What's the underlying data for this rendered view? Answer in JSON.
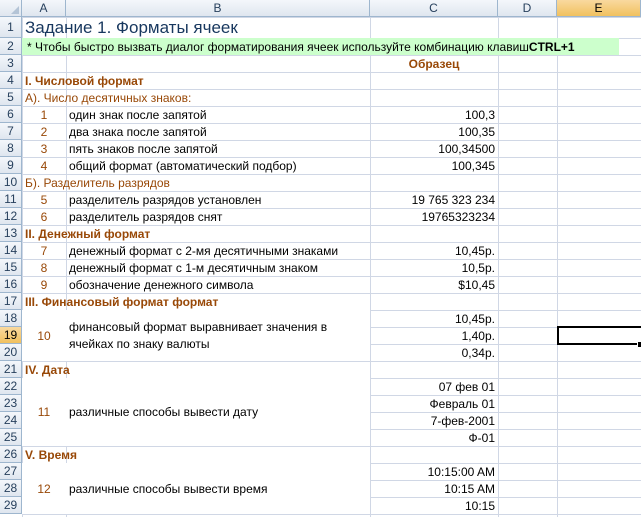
{
  "columns": [
    "A",
    "B",
    "C",
    "D",
    "E"
  ],
  "active_column": "E",
  "active_row": "19",
  "rows": [
    "1",
    "2",
    "3",
    "4",
    "5",
    "6",
    "7",
    "8",
    "9",
    "10",
    "11",
    "12",
    "13",
    "14",
    "15",
    "16",
    "17",
    "18",
    "19",
    "20",
    "21",
    "22",
    "23",
    "24",
    "25",
    "26",
    "27",
    "28",
    "29"
  ],
  "cells": {
    "title": "Задание 1. Форматы ячеек",
    "hint_text": "* Чтобы быстро вызвать диалог форматирования ячеек используйте комбинацию клавиш ",
    "hint_key": "CTRL+1",
    "sample_header": "Образец",
    "sec1": "I. Числовой формат",
    "sec1a": "А). Число десятичных знаков:",
    "n6": "1",
    "d6": "один знак после запятой",
    "v6": "100,3",
    "n7": "2",
    "d7": "два знака после запятой",
    "v7": "100,35",
    "n8": "3",
    "d8": "пять знаков после запятой",
    "v8": "100,34500",
    "n9": "4",
    "d9": "общий формат (автоматический подбор)",
    "v9": "100,345",
    "sec1b": "Б). Разделитель разрядов",
    "n11": "5",
    "d11": "разделитель разрядов установлен",
    "v11": "19 765 323 234",
    "n12": "6",
    "d12": "разделитель разрядов снят",
    "v12": "19765323234",
    "sec2": "II. Денежный формат",
    "n14": "7",
    "d14": "денежный формат с 2-мя десятичными знаками",
    "v14": "10,45р.",
    "n15": "8",
    "d15": "денежный формат с 1-м  десятичным знаком",
    "v15": "10,5р.",
    "n16": "9",
    "d16": "обозначение денежного символа",
    "v16": "$10,45",
    "sec3": "III. Финансовый формат формат",
    "n18": "10",
    "d18": "финансовый формат выравнивает значения в ячейках по знаку валюты",
    "v18": "10,45р.",
    "v19": "1,40р.",
    "v20": "0,34р.",
    "sec4": "IV. Дата",
    "n22": "11",
    "d22": "различные способы вывести дату",
    "v22": "07 фев 01",
    "v23": "Февраль 01",
    "v24": "7-фев-2001",
    "v25": "Ф-01",
    "sec5": "V. Время",
    "n27": "12",
    "d27": "различные способы вывести время",
    "v27": "10:15:00 AM",
    "v28": "10:15 AM",
    "v29": "10:15"
  }
}
